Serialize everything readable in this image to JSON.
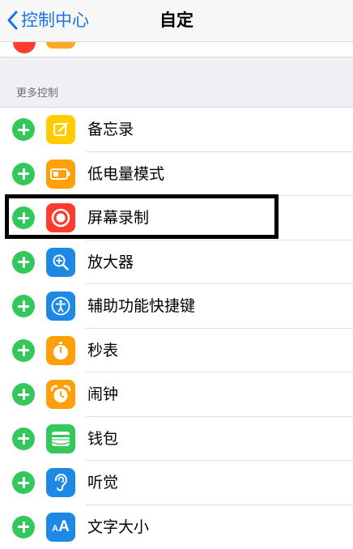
{
  "navbar": {
    "back_label": "控制中心",
    "title": "自定"
  },
  "section": {
    "header": "更多控制"
  },
  "rows": [
    {
      "label": "备忘录",
      "icon": "notes-icon",
      "color": "#ffcc00"
    },
    {
      "label": "低电量模式",
      "icon": "battery-icon",
      "color": "#ff9f0a"
    },
    {
      "label": "屏幕录制",
      "icon": "record-icon",
      "color": "#ff3b30"
    },
    {
      "label": "放大器",
      "icon": "magnifier-icon",
      "color": "#1e88e5"
    },
    {
      "label": "辅助功能快捷键",
      "icon": "accessibility-icon",
      "color": "#1e88e5"
    },
    {
      "label": "秒表",
      "icon": "stopwatch-icon",
      "color": "#ff9f0a"
    },
    {
      "label": "闹钟",
      "icon": "alarm-icon",
      "color": "#ff9f0a"
    },
    {
      "label": "钱包",
      "icon": "wallet-icon",
      "color": "#34c759"
    },
    {
      "label": "听觉",
      "icon": "ear-icon",
      "color": "#1e88e5"
    },
    {
      "label": "文字大小",
      "icon": "text-size-icon",
      "color": "#1e88e5",
      "icon_text": "AA"
    }
  ],
  "colors": {
    "accent": "#1a73e8",
    "add": "#34c759",
    "remove": "#ff3b30"
  }
}
